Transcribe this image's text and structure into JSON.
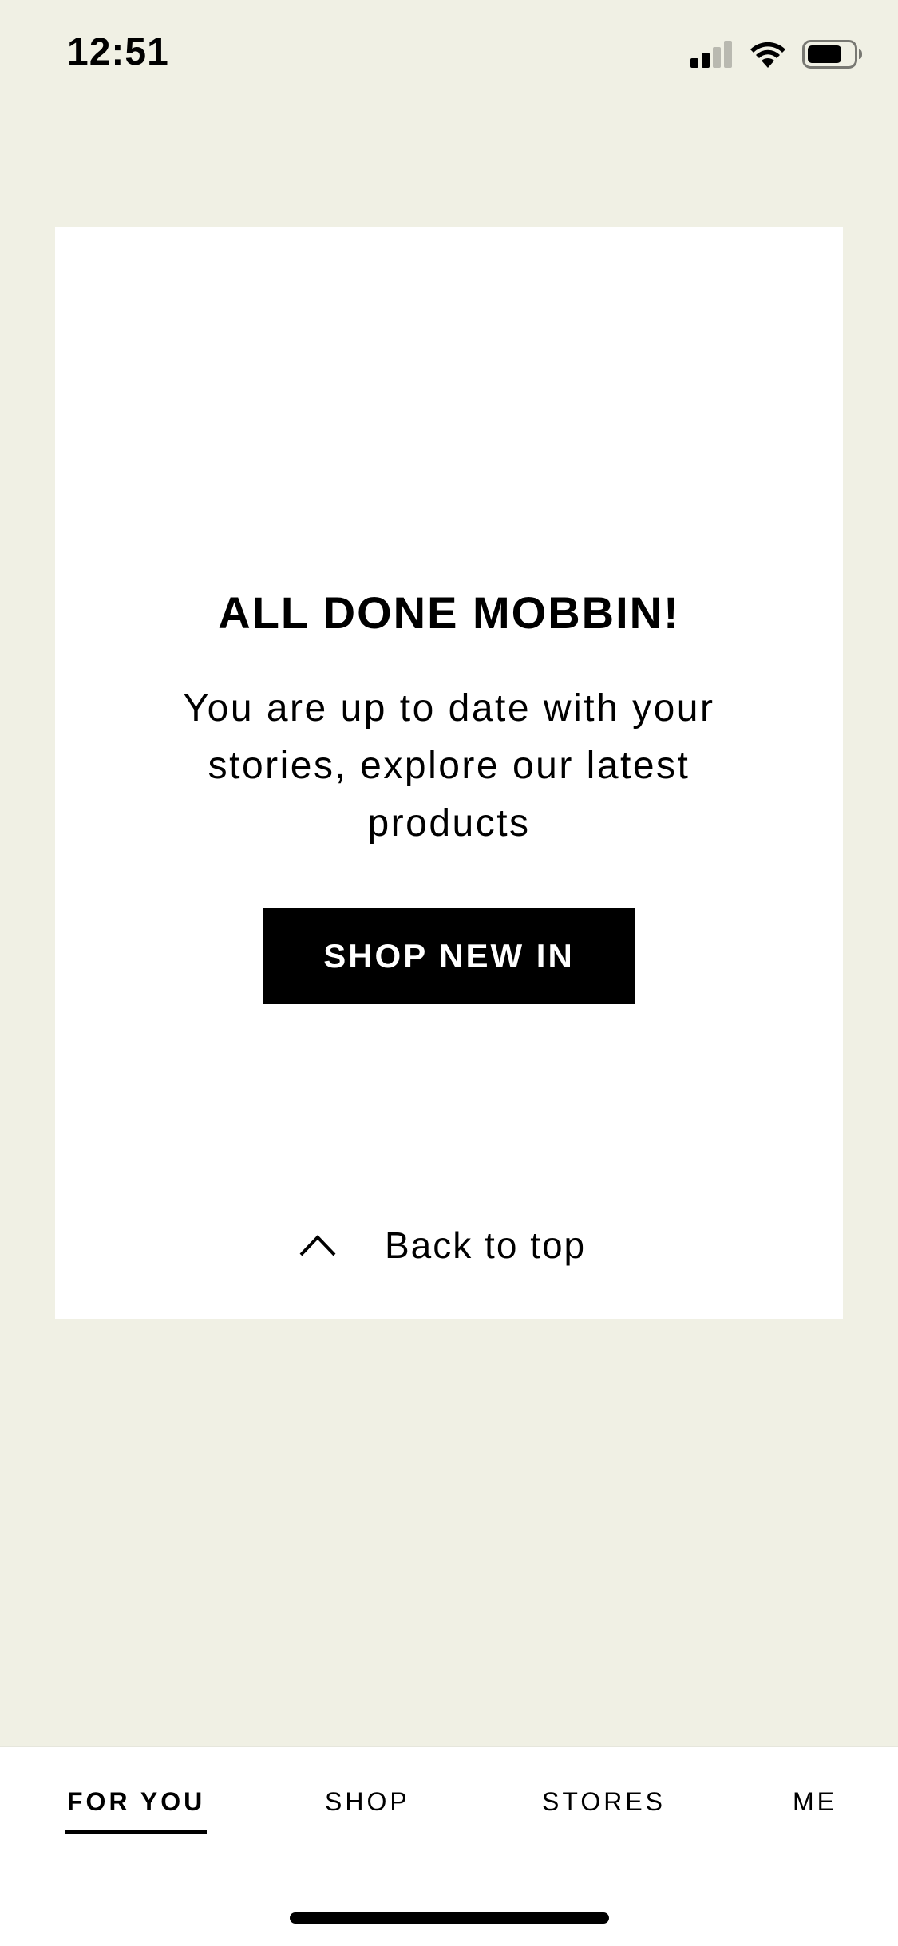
{
  "status_bar": {
    "time": "12:51"
  },
  "card": {
    "title": "ALL DONE MOBBIN!",
    "message": "You are up to date with your stories, explore our latest products",
    "button_label": "SHOP NEW IN",
    "back_to_top_label": "Back to top"
  },
  "tabs": [
    {
      "label": "FOR YOU",
      "active": true
    },
    {
      "label": "SHOP",
      "active": false
    },
    {
      "label": "STORES",
      "active": false
    },
    {
      "label": "ME",
      "active": false
    }
  ],
  "colors": {
    "background": "#f0f0e4",
    "card": "#ffffff",
    "button": "#000000",
    "button_text": "#ffffff"
  },
  "icons": [
    "signal-icon",
    "wifi-icon",
    "battery-icon",
    "chevron-up-icon"
  ]
}
